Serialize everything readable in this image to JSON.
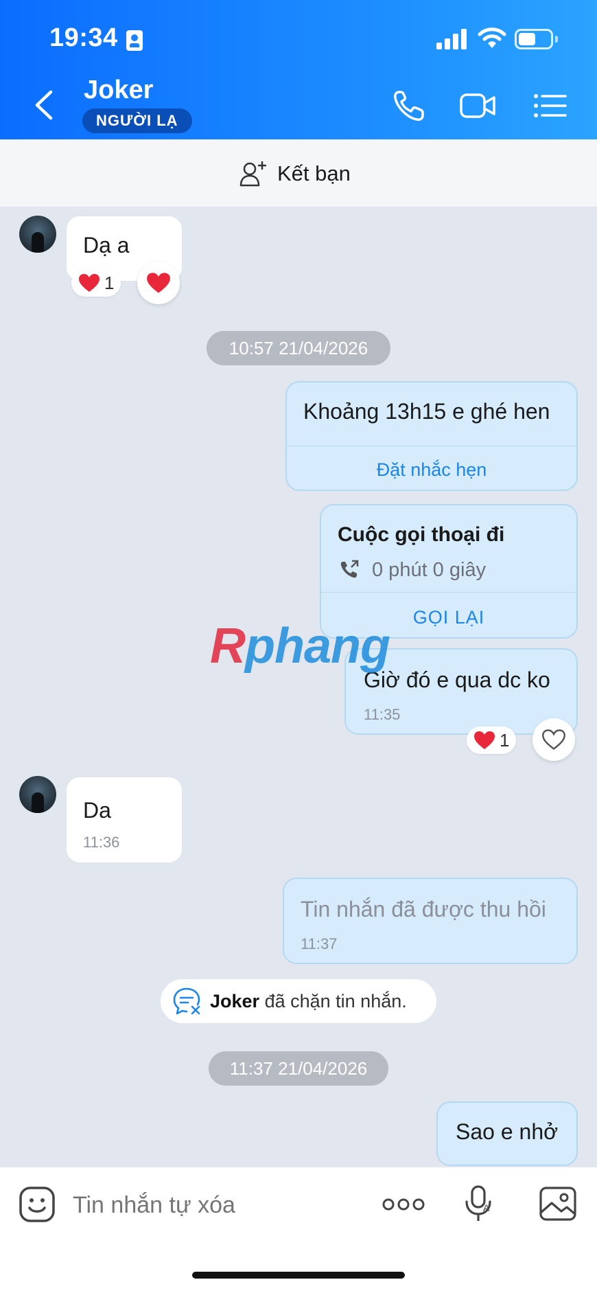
{
  "status_bar": {
    "time": "19:34"
  },
  "header": {
    "contact_name": "Joker",
    "badge": "NGƯỜI LẠ"
  },
  "friend_bar": {
    "label": "Kết bạn"
  },
  "messages": [
    {
      "dir": "in",
      "text": "Dạ a",
      "reaction_count": "1"
    },
    {
      "type": "date",
      "text": "10:57 21/04/2026"
    },
    {
      "dir": "out",
      "text": "Khoảng 13h15 e ghé hen",
      "action": "Đặt nhắc hẹn"
    },
    {
      "dir": "out",
      "type": "call",
      "title": "Cuộc gọi thoại đi",
      "duration": "0 phút 0 giây",
      "action": "GỌI LẠI"
    },
    {
      "dir": "out",
      "text": "Giờ đó e qua dc ko",
      "time": "11:35",
      "reaction_count": "1"
    },
    {
      "dir": "in",
      "text": "Da",
      "time": "11:36"
    },
    {
      "dir": "out",
      "text": "Tin nhắn đã được thu hồi",
      "time": "11:37"
    },
    {
      "type": "system",
      "name": "Joker",
      "text": "đã chặn tin nhắn."
    },
    {
      "type": "date",
      "text": "11:37 21/04/2026"
    },
    {
      "dir": "out",
      "text": "Sao e nhở"
    }
  ],
  "watermark": {
    "part1": "R",
    "part2": "phang"
  },
  "input": {
    "placeholder": "Tin nhắn tự xóa"
  },
  "colors": {
    "header_start": "#0b6dff",
    "header_end": "#2aa4ff",
    "out_bubble": "#d6ebfb",
    "link": "#1c85e8",
    "heart": "#e8283a"
  },
  "icons": [
    "back-icon",
    "call-icon",
    "video-icon",
    "menu-icon",
    "add-friend-icon",
    "heart-icon",
    "phone-outgoing-icon",
    "block-message-icon",
    "sticker-icon",
    "more-icon",
    "voice-icon",
    "image-icon"
  ]
}
